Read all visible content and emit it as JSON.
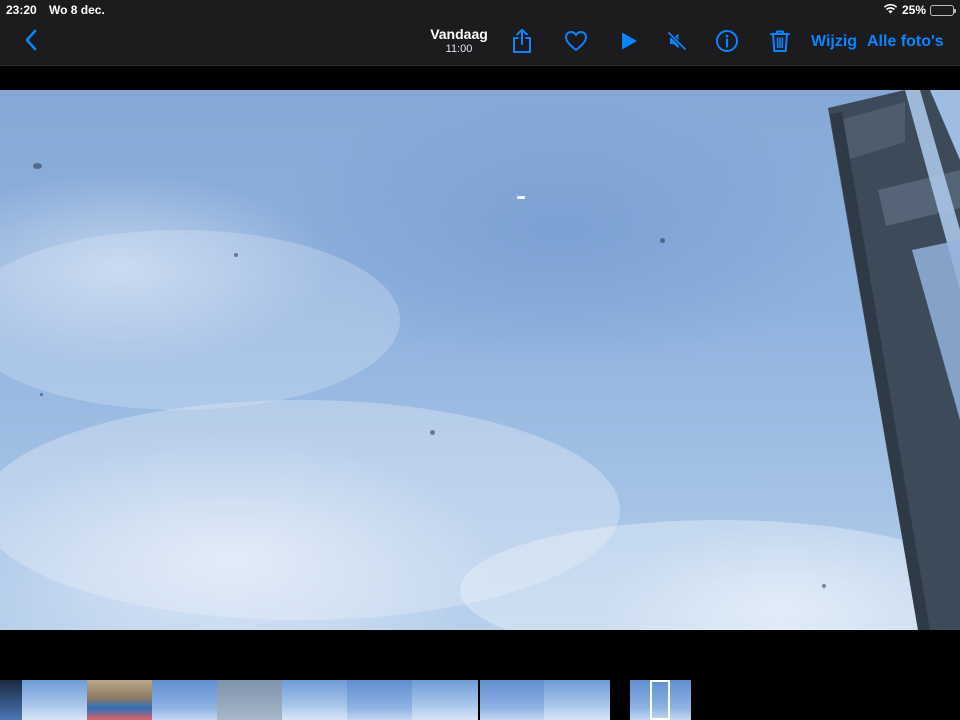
{
  "status": {
    "time": "23:20",
    "date": "Wo 8 dec.",
    "battery_percent": "25%",
    "battery_level": 0.25
  },
  "nav": {
    "title": "Vandaag",
    "subtitle": "11:00",
    "edit_label": "Wijzig",
    "all_photos_label": "Alle foto's",
    "icons": [
      "chevron-left-icon",
      "share-icon",
      "heart-icon",
      "play-icon",
      "speaker-muted-icon",
      "info-icon",
      "trash-icon"
    ]
  },
  "colors": {
    "accent": "#0a84ff",
    "bar_background": "#1c1c1e",
    "background": "#000000"
  },
  "filmstrip": {
    "selected_index": 11
  }
}
